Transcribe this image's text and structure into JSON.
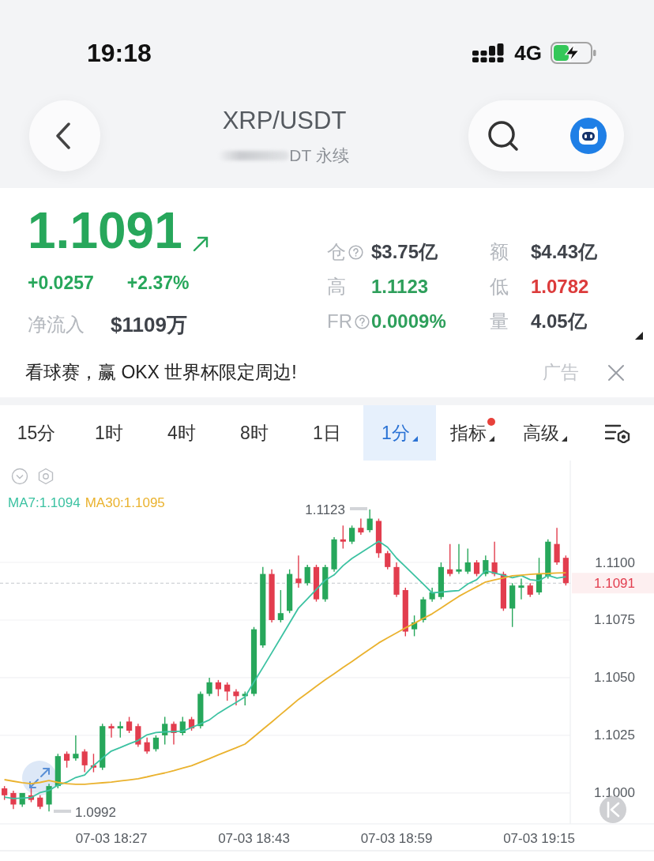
{
  "status_bar": {
    "time": "19:18",
    "network": "4G"
  },
  "nav": {
    "title": "XRP/USDT",
    "subtitle": "DT 永续"
  },
  "ticker": {
    "price": "1.1091",
    "change": "+0.0257",
    "change_percent": "+2.37%",
    "net_inflow_label": "净流入",
    "net_inflow": "$1109万",
    "stats": [
      {
        "label": "仓",
        "info": true,
        "value": "$3.75亿",
        "color": "#3f434a"
      },
      {
        "label": "额",
        "info": false,
        "value": "$4.43亿",
        "color": "#3f434a"
      },
      {
        "label": "高",
        "info": false,
        "value": "1.1123",
        "color": "#2e9f5b"
      },
      {
        "label": "低",
        "info": false,
        "value": "1.0782",
        "color": "#dc3b3b"
      },
      {
        "label": "FR",
        "info": true,
        "value": "0.0009%",
        "color": "#2e9f5b"
      },
      {
        "label": "量",
        "info": false,
        "value": "4.05亿",
        "color": "#3f434a"
      }
    ]
  },
  "ad": {
    "text": "看球赛，赢 OKX 世界杯限定周边!",
    "tag": "广告"
  },
  "intervals": [
    {
      "label": "15分",
      "selected": false,
      "dropdown": false,
      "badge": false
    },
    {
      "label": "1时",
      "selected": false,
      "dropdown": false,
      "badge": false
    },
    {
      "label": "4时",
      "selected": false,
      "dropdown": false,
      "badge": false
    },
    {
      "label": "8时",
      "selected": false,
      "dropdown": false,
      "badge": false
    },
    {
      "label": "1日",
      "selected": false,
      "dropdown": false,
      "badge": false
    },
    {
      "label": "1分",
      "selected": true,
      "dropdown": true,
      "badge": false
    },
    {
      "label": "指标",
      "selected": false,
      "dropdown": true,
      "badge": true
    },
    {
      "label": "高级",
      "selected": false,
      "dropdown": true,
      "badge": false
    }
  ],
  "chart": {
    "high_label": "1.1123",
    "low_label": "1.0992",
    "chart_data": {
      "type": "candlestick",
      "categories": [
        null,
        null,
        null,
        null,
        null,
        null,
        null,
        null,
        null,
        null,
        null,
        null,
        "07-03 18:27",
        null,
        null,
        null,
        null,
        null,
        null,
        null,
        null,
        null,
        null,
        null,
        null,
        null,
        null,
        null,
        "07-03 18:43",
        null,
        null,
        null,
        null,
        null,
        null,
        null,
        null,
        null,
        null,
        null,
        null,
        null,
        null,
        null,
        "07-03 18:59",
        null,
        null,
        null,
        null,
        null,
        null,
        null,
        null,
        null,
        null,
        null,
        null,
        null,
        null,
        null,
        "07-03 19:15",
        null,
        null,
        null
      ],
      "ohlc": [
        [
          1.1002,
          1.1003,
          1.0997,
          1.0999
        ],
        [
          1.1,
          1.1001,
          1.0993,
          1.0995
        ],
        [
          1.0995,
          1.1,
          1.0994,
          1.1
        ],
        [
          1.0999,
          1.1002,
          1.0996,
          1.0997
        ],
        [
          1.0998,
          1.0999,
          1.0993,
          1.0994
        ],
        [
          1.0995,
          1.1004,
          1.0992,
          1.1003
        ],
        [
          1.1003,
          1.1017,
          1.1002,
          1.1016
        ],
        [
          1.1017,
          1.1018,
          1.1011,
          1.1014
        ],
        [
          1.1015,
          1.1025,
          1.1014,
          1.1017
        ],
        [
          1.1018,
          1.1019,
          1.1009,
          1.1012
        ],
        [
          1.1012,
          1.1017,
          1.1009,
          1.1011
        ],
        [
          1.1011,
          1.103,
          1.101,
          1.1029
        ],
        [
          1.1029,
          1.103,
          1.1024,
          1.1028
        ],
        [
          1.1028,
          1.1031,
          1.1024,
          1.1029
        ],
        [
          1.1031,
          1.1033,
          1.1026,
          1.1027
        ],
        [
          1.1029,
          1.103,
          1.102,
          1.1021
        ],
        [
          1.1022,
          1.1024,
          1.1017,
          1.1018
        ],
        [
          1.1019,
          1.1025,
          1.1018,
          1.1024
        ],
        [
          1.1025,
          1.1033,
          1.1021,
          1.103
        ],
        [
          1.103,
          1.1031,
          1.1021,
          1.1026
        ],
        [
          1.1026,
          1.1033,
          1.1025,
          1.1031
        ],
        [
          1.1032,
          1.1033,
          1.1027,
          1.1028
        ],
        [
          1.1029,
          1.1044,
          1.1028,
          1.1043
        ],
        [
          1.1043,
          1.105,
          1.1042,
          1.1048
        ],
        [
          1.1048,
          1.1049,
          1.1042,
          1.1045
        ],
        [
          1.1047,
          1.1048,
          1.104,
          1.1044
        ],
        [
          1.1044,
          1.1045,
          1.1038,
          1.1042
        ],
        [
          1.1042,
          1.1044,
          1.1038,
          1.1043
        ],
        [
          1.1043,
          1.1072,
          1.1042,
          1.1071
        ],
        [
          1.1064,
          1.1098,
          1.1063,
          1.1095
        ],
        [
          1.1095,
          1.1097,
          1.1074,
          1.1075
        ],
        [
          1.1075,
          1.1088,
          1.1074,
          1.1078
        ],
        [
          1.1079,
          1.1097,
          1.1078,
          1.1095
        ],
        [
          1.1093,
          1.1103,
          1.1089,
          1.1091
        ],
        [
          1.1091,
          1.1099,
          1.109,
          1.1098
        ],
        [
          1.1098,
          1.1099,
          1.1083,
          1.1084
        ],
        [
          1.1084,
          1.1099,
          1.1083,
          1.1098
        ],
        [
          1.1097,
          1.1111,
          1.1096,
          1.111
        ],
        [
          1.111,
          1.1116,
          1.1106,
          1.1109
        ],
        [
          1.1109,
          1.1116,
          1.1108,
          1.1115
        ],
        [
          1.1115,
          1.1119,
          1.1112,
          1.1113
        ],
        [
          1.1114,
          1.1123,
          1.1113,
          1.1119
        ],
        [
          1.1118,
          1.1119,
          1.1102,
          1.1104
        ],
        [
          1.1104,
          1.1105,
          1.1097,
          1.1098
        ],
        [
          1.1098,
          1.11,
          1.1085,
          1.1086
        ],
        [
          1.1088,
          1.1089,
          1.1068,
          1.107
        ],
        [
          1.1071,
          1.1077,
          1.1068,
          1.1074
        ],
        [
          1.1075,
          1.1085,
          1.1074,
          1.1084
        ],
        [
          1.1084,
          1.1089,
          1.1083,
          1.1087
        ],
        [
          1.1085,
          1.11,
          1.1084,
          1.1098
        ],
        [
          1.1097,
          1.1108,
          1.1094,
          1.1095
        ],
        [
          1.1096,
          1.1108,
          1.1095,
          1.1097
        ],
        [
          1.1096,
          1.1106,
          1.1095,
          1.11
        ],
        [
          1.11,
          1.1101,
          1.1094,
          1.1095
        ],
        [
          1.1095,
          1.1103,
          1.1094,
          1.1101
        ],
        [
          1.11,
          1.1109,
          1.1094,
          1.1095
        ],
        [
          1.1095,
          1.1096,
          1.1079,
          1.108
        ],
        [
          1.108,
          1.1091,
          1.1072,
          1.109
        ],
        [
          1.1089,
          1.1093,
          1.1084,
          1.109
        ],
        [
          1.109,
          1.1091,
          1.1085,
          1.1086
        ],
        [
          1.1087,
          1.1102,
          1.1086,
          1.1095
        ],
        [
          1.1094,
          1.111,
          1.1093,
          1.1109
        ],
        [
          1.1108,
          1.1115,
          1.1099,
          1.11
        ],
        [
          1.1102,
          1.1103,
          1.109,
          1.1091
        ]
      ],
      "series": [
        {
          "name": "MA7:1.1094",
          "type": "line",
          "color": "#3cc2a2",
          "values": [
            1.09982,
            1.09976,
            1.09978,
            1.0998,
            1.10002,
            1.10011,
            1.10034,
            1.10047,
            1.10067,
            1.10078,
            1.10119,
            1.10151,
            1.10182,
            1.10197,
            1.10213,
            1.10228,
            1.10252,
            1.10262,
            1.10265,
            1.10266,
            1.10268,
            1.10284,
            1.103,
            1.10317,
            1.10346,
            1.1037,
            1.10393,
            1.10417,
            1.10481,
            1.10544,
            1.10608,
            1.10673,
            1.10737,
            1.10802,
            1.10842,
            1.10883,
            1.10923,
            1.10946,
            1.10986,
            1.11017,
            1.11042,
            1.11067,
            1.11092,
            1.11066,
            1.11019,
            1.10982,
            1.10944,
            1.10906,
            1.10868,
            1.10871,
            1.10875,
            1.10878,
            1.10907,
            1.10925,
            1.10964,
            1.10954,
            1.10944,
            1.10934,
            1.10943,
            1.10925,
            1.10921,
            1.10944,
            1.10932,
            1.10938
          ]
        },
        {
          "name": "MA30:1.1095",
          "type": "line",
          "color": "#eab22e",
          "values": [
            1.10058,
            1.10051,
            1.10045,
            1.1004,
            1.10046,
            1.10054,
            1.10046,
            1.1004,
            1.10038,
            1.10038,
            1.10041,
            1.10044,
            1.10047,
            1.10052,
            1.10057,
            1.10062,
            1.1007,
            1.10079,
            1.10087,
            1.10097,
            1.10108,
            1.10118,
            1.10134,
            1.10149,
            1.10165,
            1.10181,
            1.10196,
            1.10212,
            1.10244,
            1.10276,
            1.10308,
            1.10341,
            1.10373,
            1.10406,
            1.10434,
            1.10463,
            1.10491,
            1.10517,
            1.10544,
            1.1057,
            1.10597,
            1.10624,
            1.10651,
            1.10673,
            1.10694,
            1.10716,
            1.10736,
            1.10757,
            1.10777,
            1.10802,
            1.10828,
            1.10853,
            1.10874,
            1.10894,
            1.10915,
            1.10924,
            1.10933,
            1.10942,
            1.10945,
            1.10948,
            1.10951,
            1.10952,
            1.10954,
            1.10955
          ]
        }
      ],
      "ylim": [
        1.09866,
        1.11442
      ],
      "yticks": [
        {
          "value": 1.11,
          "label": "1.1100"
        },
        {
          "value": 1.1075,
          "label": "1.1075"
        },
        {
          "value": 1.105,
          "label": "1.1050"
        },
        {
          "value": 1.1025,
          "label": "1.1025"
        },
        {
          "value": 1.1,
          "label": "1.1000"
        }
      ],
      "grid": true,
      "ref_lines": [
        {
          "axis": "y",
          "value": 1.1091,
          "label": "1.1091"
        }
      ]
    }
  }
}
